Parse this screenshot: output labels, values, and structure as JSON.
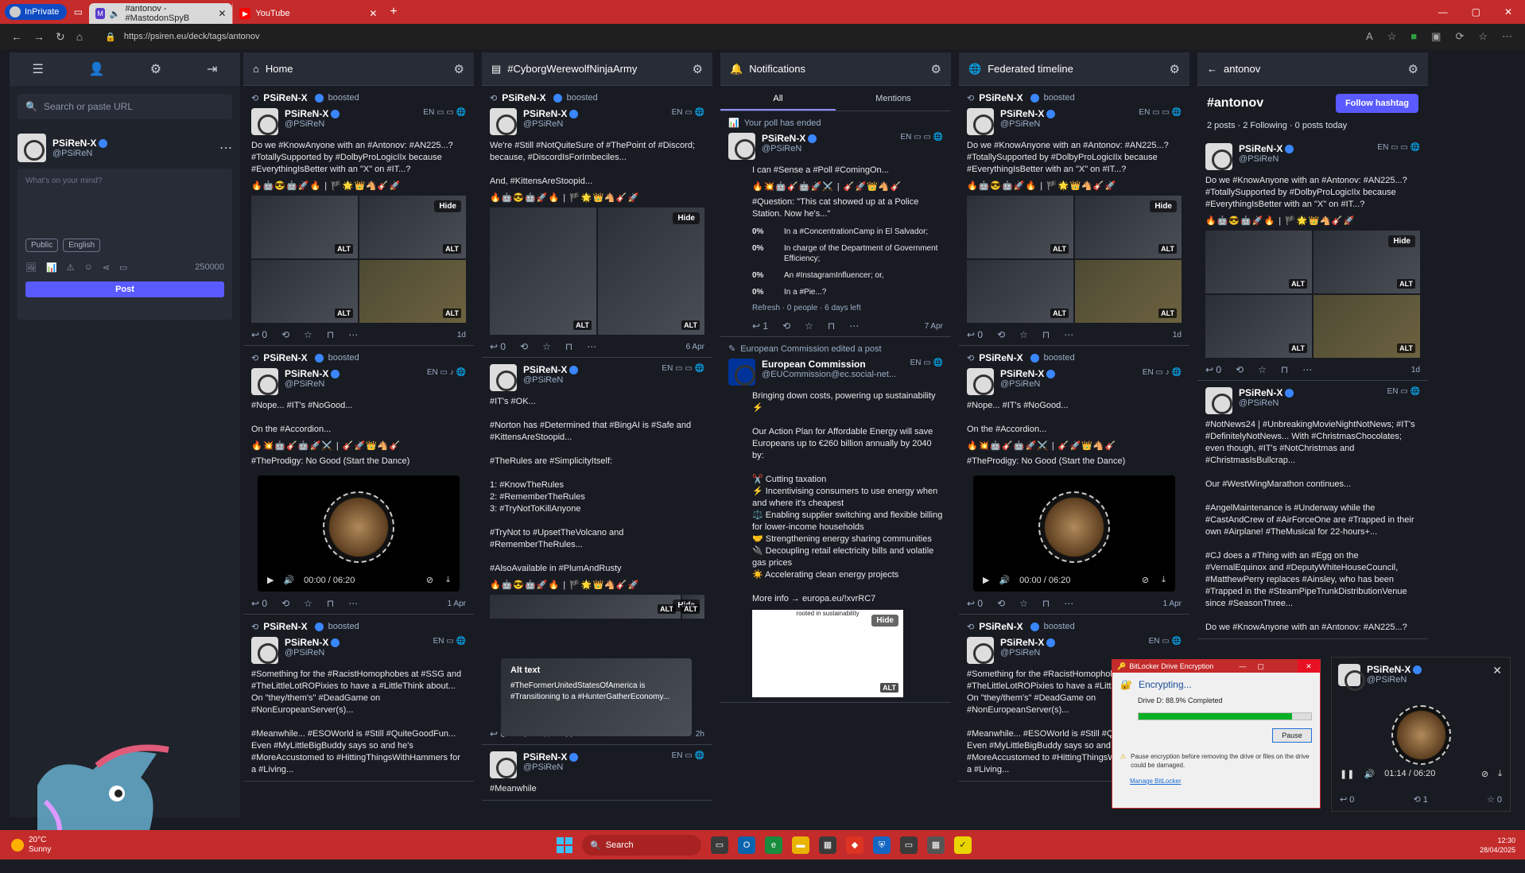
{
  "browser": {
    "inprivate": "InPrivate",
    "tabs": [
      {
        "title": "#antonov - #MastodonSpyB",
        "fav": "M"
      },
      {
        "title": "YouTube",
        "fav": "▶"
      }
    ],
    "url": "https://psiren.eu/deck/tags/antonov"
  },
  "drawer": {
    "search_placeholder": "Search or paste URL",
    "account": {
      "name": "PSiReN-X",
      "handle": "@PSiReN"
    },
    "compose": {
      "placeholder": "What's on your mind?",
      "visibility": "Public",
      "language": "English",
      "char_count": "250000",
      "post_label": "Post"
    }
  },
  "columns": {
    "home": {
      "title": "Home"
    },
    "cyber": {
      "title": "#CyborgWerewolfNinjaArmy"
    },
    "notif": {
      "title": "Notifications",
      "tab_all": "All",
      "tab_mentions": "Mentions"
    },
    "fed": {
      "title": "Federated timeline"
    },
    "antonov": {
      "title": "antonov",
      "hashtag": "#antonov",
      "follow": "Follow hashtag",
      "stats": "2 posts · 2 Following · 0 posts today"
    }
  },
  "posts": {
    "boosted": "PSiReN-X",
    "boosted_word": "boosted",
    "author": "PSiReN-X",
    "handle": "@PSiReN",
    "lang": "EN",
    "p1_text": "Do we #KnowAnyone with an #Antonov: #AN225...? #TotallySupported by #DolbyProLogicIIx because #EverythingIsBetter with an \"X\" on #IT...?",
    "p1_emoji": "🔥🤖😎🤖🚀🔥 | 🏴🌟👑🐴🎸🚀",
    "p2_text": "#Nope... #IT's #NoGood...\n\nOn the #Accordion...",
    "p2_emoji": "🔥💥🤖🎸🤖🚀⚔️ | 🎸🚀👑🐴🎸",
    "p2_track": "#TheProdigy: No Good (Start the Dance)",
    "audio_time": "00:00 / 06:20",
    "p3_text": "#Something for the #RacistHomophobes at #SSG and #TheLittleLotROPixies to have a #LittleThink about... On \"they/them's\" #DeadGame on #NonEuropeanServer(s)...\n\n#Meanwhile... #ESOWorld is #Still #QuiteGoodFun... Even #MyLittleBigBuddy says so and he's #MoreAccustomed to #HittingThingsWithHammers for a #Living...",
    "time_1d": "1d",
    "time_1apr": "1 Apr",
    "c1_text": "We're #Still #NotQuiteSure of #ThePoint of #Discord; because, #DiscordIsForImbeciles...\n\nAnd, #KittensAreStoopid...",
    "c1_time": "6 Apr",
    "c2_text": "#IT's #OK...\n\n#Norton has #Determined that #BingAI is #Safe and #KittensAreStoopid...\n\n#TheRules are #SimplicityItself:\n\n1: #KnowTheRules\n2: #RememberTheRules\n3: #TryNotToKillAnyone\n\n#TryNot to #UpsetTheVolcano and #RememberTheRules...\n\n#AlsoAvailable in #PlumAndRusty",
    "c2_time": "2h",
    "alt_title": "Alt text",
    "alt_body": "#TheFormerUnitedStatesOfAmerica is #Transitioning to a #HunterGatherEconomy...",
    "c3_text": "#Meanwhile",
    "poll_ended": "Your poll has ended",
    "poll_text": "I can #Sense a #Poll #ComingOn...",
    "poll_question": "#Question: \"This cat showed up at a Police Station. Now he's...\"",
    "poll_options": [
      {
        "pct": "0%",
        "label": "In a #ConcentrationCamp in El Salvador;"
      },
      {
        "pct": "0%",
        "label": "In charge of the Department of Government Efficiency;"
      },
      {
        "pct": "0%",
        "label": "An #InstagramInfluencer; or,"
      },
      {
        "pct": "0%",
        "label": "In a #Pie...?"
      }
    ],
    "poll_footer": "Refresh · 0 people · 6 days left",
    "poll_time": "7 Apr",
    "ec_edit": "European Commission edited a post",
    "ec_name": "European Commission",
    "ec_handle": "@EUCommission@ec.social-net...",
    "ec_text": "Bringing down costs, powering up sustainability ⚡\n\nOur Action Plan for Affordable Energy will save Europeans up to €260 billion annually by 2040 by:\n\n✂️ Cutting taxation\n⚡ Incentivising consumers to use energy when and where it's cheapest\n⚖️ Enabling supplier switching and flexible billing for lower-income households\n🤝 Strengthening energy sharing communities\n🔌 Decoupling retail electricity bills and volatile gas prices\n☀️ Accelerating clean energy projects\n\nMore info → europa.eu/!xvrRC7",
    "ec_image": "rooted in sustainability",
    "a2_text": "#NotNews24 | #UnbreakingMovieNightNotNews; #IT's #DefinitelyNotNews... With #ChristmasChocolates; even though, #IT's #NotChristmas and #ChristmasIsBullcrap...\n\nOur #WestWingMarathon continues...\n\n#AngelMaintenance is #Underway while the #CastAndCrew of #AirForceOne are #Trapped in their own #Airplane! #TheMusical for 22-hours+...\n\n#CJ does a #Thing with an #Egg on the #VernalEquinox and #DeputyWhiteHouseCouncil, #MatthewPerry replaces #Ainsley, who has been #Trapped in the #SteamPipeTrunkDistributionVenue since #SeasonThree...\n\nDo we #KnowAnyone with an #Antonov: #AN225...?",
    "counts": {
      "zero": "0",
      "one": "1"
    }
  },
  "bitlocker": {
    "title": "BitLocker Drive Encryption",
    "heading": "Encrypting...",
    "drive": "Drive D: 88.9% Completed",
    "progress": 0.889,
    "pause": "Pause",
    "warning": "Pause encryption before removing the drive or files on the drive could be damaged.",
    "manage": "Manage BitLocker"
  },
  "pip": {
    "name": "PSiReN-X",
    "handle": "@PSiReN",
    "time": "01:14 / 06:20"
  },
  "taskbar": {
    "temp": "20°C",
    "weather": "Sunny",
    "search": "Search",
    "time": "12:30",
    "date": "28/04/2025"
  },
  "colors": {
    "accent": "#595aff",
    "tag": "#8c8dff",
    "bg": "#191b22",
    "panel": "#282c37",
    "titlebar": "#c42b2b"
  }
}
